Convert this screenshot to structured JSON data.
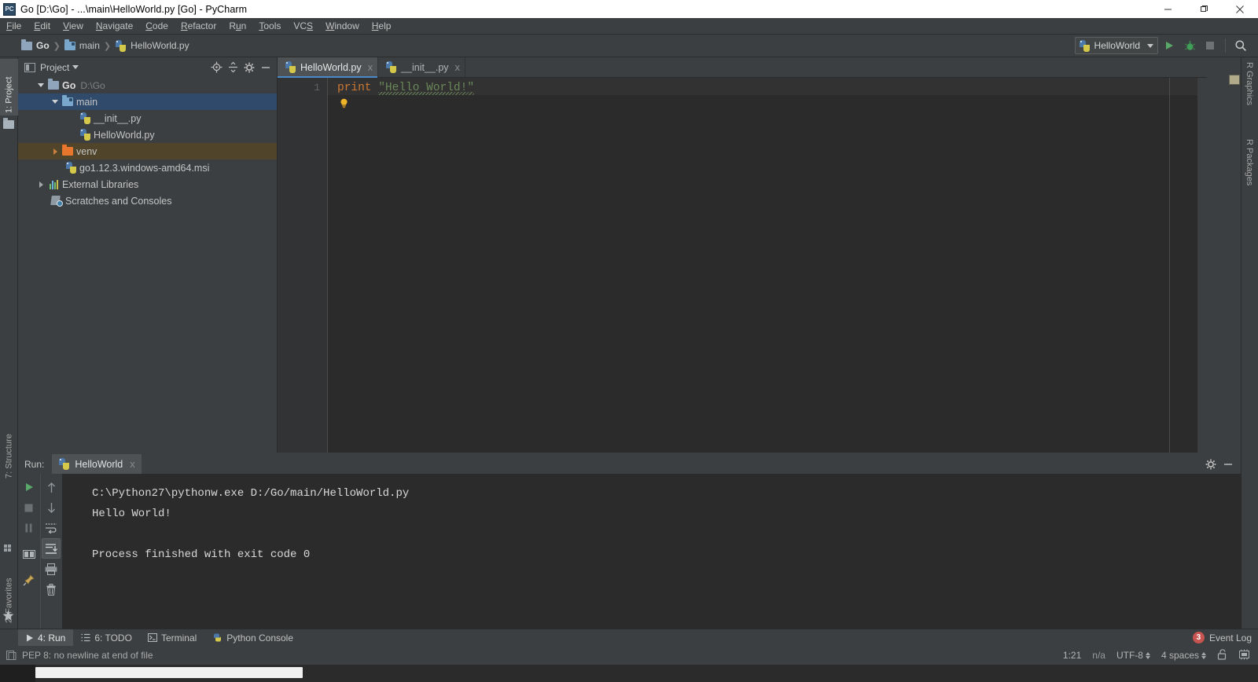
{
  "window": {
    "title": "Go [D:\\Go] - ...\\main\\HelloWorld.py [Go] - PyCharm",
    "app_icon": "PC",
    "minimize": "minimize-icon",
    "restore": "restore-icon",
    "close": "close-icon"
  },
  "menubar": {
    "items": [
      {
        "label": "File",
        "mnemonic": "F"
      },
      {
        "label": "Edit",
        "mnemonic": "E"
      },
      {
        "label": "View",
        "mnemonic": "V"
      },
      {
        "label": "Navigate",
        "mnemonic": "N"
      },
      {
        "label": "Code",
        "mnemonic": "C"
      },
      {
        "label": "Refactor",
        "mnemonic": "R"
      },
      {
        "label": "Run",
        "mnemonic": "u"
      },
      {
        "label": "Tools",
        "mnemonic": "T"
      },
      {
        "label": "VCS",
        "mnemonic": "S"
      },
      {
        "label": "Window",
        "mnemonic": "W"
      },
      {
        "label": "Help",
        "mnemonic": "H"
      }
    ]
  },
  "breadcrumb": {
    "items": [
      "Go",
      "main",
      "HelloWorld.py"
    ]
  },
  "toolbar": {
    "run_config": "HelloWorld",
    "run_icon": "run-triangle-icon",
    "debug_icon": "debug-bug-icon",
    "stop_icon": "stop-square-icon",
    "search_icon": "search-magnifier-icon"
  },
  "left_strip": {
    "project_label": "1: Project",
    "structure_label": "7: Structure",
    "favorites_label": "2: Favorites"
  },
  "right_strip": {
    "graphics_label": "R Graphics",
    "packages_label": "R Packages"
  },
  "project_panel": {
    "title": "Project",
    "header_icons": [
      "locate-target-icon",
      "collapse-all-icon",
      "gear-icon",
      "minimize-icon"
    ],
    "tree": [
      {
        "label": "Go",
        "sub": "D:\\Go",
        "icon": "folder-icon",
        "depth": 0,
        "state": "expanded",
        "style": "root"
      },
      {
        "label": "main",
        "sub": "",
        "icon": "source-folder-icon",
        "depth": 1,
        "state": "expanded",
        "style": "selected"
      },
      {
        "label": "__init__.py",
        "sub": "",
        "icon": "python-file-icon",
        "depth": 2,
        "state": "leaf",
        "style": "normal"
      },
      {
        "label": "HelloWorld.py",
        "sub": "",
        "icon": "python-file-icon",
        "depth": 2,
        "state": "leaf",
        "style": "normal"
      },
      {
        "label": "venv",
        "sub": "",
        "icon": "excluded-folder-icon",
        "depth": 1,
        "state": "collapsed",
        "style": "highlighted"
      },
      {
        "label": "go1.12.3.windows-amd64.msi",
        "sub": "",
        "icon": "file-icon",
        "depth": 2,
        "state": "leaf",
        "style": "normal"
      },
      {
        "label": "External Libraries",
        "sub": "",
        "icon": "libraries-icon",
        "depth": 0,
        "state": "collapsed",
        "style": "normal"
      },
      {
        "label": "Scratches and Consoles",
        "sub": "",
        "icon": "scratches-icon",
        "depth": 0,
        "state": "leaf",
        "style": "normal"
      }
    ]
  },
  "editor": {
    "tabs": [
      {
        "label": "HelloWorld.py",
        "icon": "python-file-icon",
        "active": true,
        "close": "x"
      },
      {
        "label": "__init__.py",
        "icon": "python-file-icon",
        "active": false,
        "close": "x"
      }
    ],
    "line_number": "1",
    "code": {
      "keyword": "print",
      "space": " ",
      "string": "\"Hello World!\""
    },
    "intention_icon": "lightbulb-icon",
    "colors": {
      "keyword": "#CC7832",
      "string": "#6A8759",
      "background": "#2B2B2B",
      "gutter": "#313335"
    }
  },
  "run_panel": {
    "label": "Run:",
    "tab_label": "HelloWorld",
    "tab_icon": "python-file-icon",
    "tab_close": "x",
    "header_icons": [
      "gear-icon",
      "minimize-icon"
    ],
    "toolbar_col1": [
      "rerun-run-icon",
      "stop-icon",
      "pause-icon",
      "layout-icon",
      "pin-icon"
    ],
    "toolbar_col2": [
      "up-arrow-icon",
      "down-arrow-icon",
      "soft-wrap-icon",
      "scroll-to-end-icon",
      "print-icon",
      "trash-icon"
    ],
    "active_toolbar_icon": "scroll-to-end-icon",
    "output": [
      "C:\\Python27\\pythonw.exe D:/Go/main/HelloWorld.py",
      "Hello World!",
      "",
      "Process finished with exit code 0"
    ]
  },
  "bottom_bar": {
    "items": [
      {
        "label": "4: Run",
        "mnemonic": "4",
        "icon": "run-triangle-icon",
        "active": true
      },
      {
        "label": "6: TODO",
        "mnemonic": "6",
        "icon": "todo-list-icon",
        "active": false
      },
      {
        "label": "Terminal",
        "mnemonic": "",
        "icon": "terminal-icon",
        "active": false
      },
      {
        "label": "Python Console",
        "mnemonic": "",
        "icon": "python-console-icon",
        "active": false
      }
    ],
    "event_log": {
      "label": "Event Log",
      "count": "3",
      "badge_color": "#C75450"
    }
  },
  "status_bar": {
    "message": "PEP 8: no newline at end of file",
    "message_icon": "inspection-icon",
    "caret_position": "1:21",
    "line_separator": "n/a",
    "encoding": "UTF-8",
    "indent": "4 spaces",
    "lock_icon": "unlocked-padlock-icon",
    "memory_icon": "memory-indicator-icon"
  }
}
